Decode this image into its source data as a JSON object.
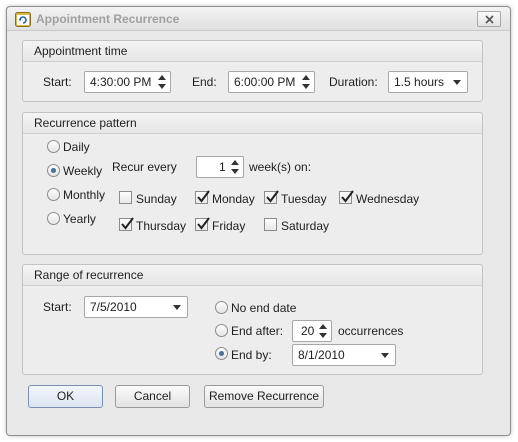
{
  "window": {
    "title": "Appointment Recurrence"
  },
  "appointment_time": {
    "heading": "Appointment time",
    "start_label": "Start:",
    "start_value": "4:30:00 PM",
    "end_label": "End:",
    "end_value": "6:00:00 PM",
    "duration_label": "Duration:",
    "duration_value": "1.5 hours"
  },
  "pattern": {
    "heading": "Recurrence pattern",
    "options": [
      "Daily",
      "Weekly",
      "Monthly",
      "Yearly"
    ],
    "selected": "Weekly",
    "recur_every_label": "Recur every",
    "recur_every_value": "1",
    "weeks_on_label": "week(s) on:",
    "days": [
      {
        "label": "Sunday",
        "checked": false
      },
      {
        "label": "Monday",
        "checked": true
      },
      {
        "label": "Tuesday",
        "checked": true
      },
      {
        "label": "Wednesday",
        "checked": true
      },
      {
        "label": "Thursday",
        "checked": true
      },
      {
        "label": "Friday",
        "checked": true
      },
      {
        "label": "Saturday",
        "checked": false
      }
    ]
  },
  "range": {
    "heading": "Range of recurrence",
    "start_label": "Start:",
    "start_value": "7/5/2010",
    "no_end_label": "No end date",
    "end_after_label": "End after:",
    "end_after_value": "20",
    "occurrences_label": "occurrences",
    "end_by_label": "End by:",
    "end_by_value": "8/1/2010",
    "selected": "end_by"
  },
  "buttons": {
    "ok": "OK",
    "cancel": "Cancel",
    "remove": "Remove Recurrence"
  },
  "colors": {
    "radio_dot": "#4a6f9a",
    "default_button": "#dbe4f2"
  }
}
